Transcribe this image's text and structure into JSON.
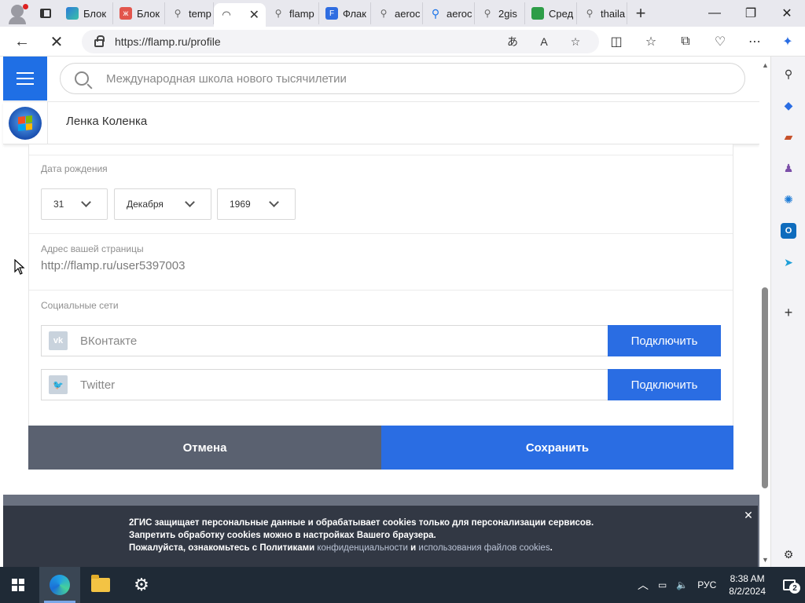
{
  "browser": {
    "tabs": [
      {
        "label": "Блок",
        "icon": "edge-icon"
      },
      {
        "label": "Блок",
        "icon": "red-circle-icon"
      },
      {
        "label": "temp",
        "icon": "search-icon"
      },
      {
        "label": "",
        "icon": "loading-icon"
      },
      {
        "label": "flamp",
        "icon": "search-icon"
      },
      {
        "label": "Флак",
        "icon": "flamp-icon"
      },
      {
        "label": "aeroc",
        "icon": "search-icon"
      },
      {
        "label": "aeroc",
        "icon": "search-icon"
      },
      {
        "label": "2gis",
        "icon": "search-icon"
      },
      {
        "label": "Сред",
        "icon": "green-circle-icon"
      },
      {
        "label": "thaila",
        "icon": "search-icon"
      }
    ],
    "url": "https://flamp.ru/profile"
  },
  "site": {
    "search_placeholder": "Международная школа нового тысячилетии",
    "user_name": "Ленка Коленка"
  },
  "profile": {
    "birth_label": "Дата рождения",
    "birth_day": "31",
    "birth_month": "Декабря",
    "birth_year": "1969",
    "address_label": "Адрес вашей страницы",
    "address_value": "http://flamp.ru/user5397003",
    "social_label": "Социальные сети",
    "social": [
      {
        "name": "ВКонтакте",
        "button": "Подключить",
        "icon": "vk-icon"
      },
      {
        "name": "Twitter",
        "button": "Подключить",
        "icon": "twitter-icon"
      }
    ],
    "cancel_label": "Отмена",
    "save_label": "Сохранить"
  },
  "cookie": {
    "line1": "2ГИС защищает персональные данные и обрабатывает cookies только для персонализации сервисов.",
    "line2": "Запретить обработку cookies можно в настройках Вашего браузера.",
    "line3_a": "Пожалуйста, ознакомьтесь с Политиками",
    "line3_link1": "конфиденциальности",
    "line3_and": "и",
    "line3_link2": "использования файлов cookies",
    "line3_end": "."
  },
  "taskbar": {
    "language": "РУС",
    "time": "8:38 AM",
    "date": "8/2/2024",
    "notification_count": "2"
  },
  "colors": {
    "accent": "#2a6de3",
    "cancel": "#5a6170",
    "cookie_bg": "#303642"
  }
}
